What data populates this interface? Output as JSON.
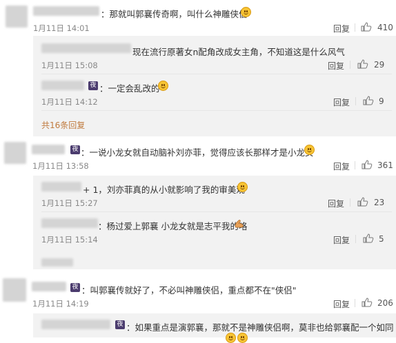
{
  "comments": [
    {
      "text": "：那就叫郭襄传奇啊，叫什么神雕侠侣",
      "time": "1月11日 14:01",
      "reply_label": "回复",
      "likes": "410",
      "replies": [
        {
          "text": "现在流行原著女n配角改成女主角，不知道这是什么风气",
          "time": "1月11日 15:08",
          "reply_label": "回复",
          "likes": "29"
        },
        {
          "badge": "夜",
          "text": "：一定会乱改的",
          "time": "1月11日 14:12",
          "reply_label": "回复",
          "likes": "9"
        }
      ],
      "more_label": "共16条回复"
    },
    {
      "badge": "夜",
      "text": "：一说小龙女就自动脑补刘亦菲，觉得应该长那样才是小龙女",
      "time": "1月11日 13:58",
      "reply_label": "回复",
      "likes": "361",
      "replies": [
        {
          "text": "+ 1，刘亦菲真的从小就影响了我的审美观",
          "time": "1月11日 15:27",
          "reply_label": "回复",
          "likes": "23"
        },
        {
          "text": "：杨过爱上郭襄 小龙女就是志平我的咯",
          "time": "1月11日 15:14",
          "reply_label": "回复",
          "likes": "5"
        }
      ]
    },
    {
      "badge": "夜",
      "text": "：叫郭襄传就好了，不必叫神雕侠侣，重点都不在\"侠侣\"",
      "time": "1月11日 14:19",
      "reply_label": "回复",
      "likes": "206",
      "replies": [
        {
          "badge": "夜",
          "text": "：如果重点是演郭襄，那就不是神雕侠侣啊，莫非也给郭襄配一个如同"
        }
      ]
    }
  ],
  "colors": {
    "more_link": "#c07b3f",
    "sub_bg": "#f2f2f2",
    "badge": "#4b3c6e"
  },
  "icons": {
    "like": "thumbs-up-icon",
    "emoji": "emoji-icon",
    "muscle": "flexed-biceps-icon"
  }
}
